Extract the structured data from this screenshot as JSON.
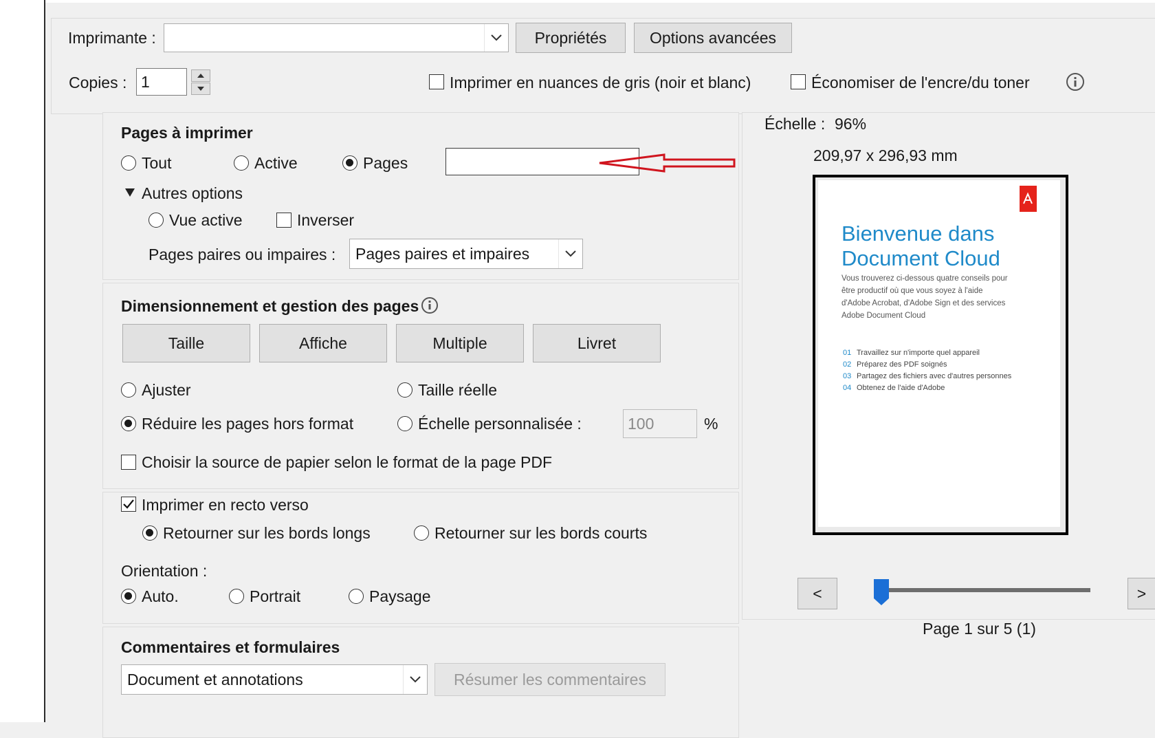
{
  "top": {
    "printer_label": "Imprimante :",
    "printer_value": "",
    "properties_button": "Propriétés",
    "advanced_button": "Options avancées",
    "copies_label": "Copies :",
    "copies_value": "1",
    "grayscale_label": "Imprimer en nuances de gris (noir et blanc)",
    "grayscale_checked": false,
    "save_ink_label": "Économiser de l'encre/du toner",
    "save_ink_checked": false
  },
  "pages_to_print": {
    "title": "Pages à imprimer",
    "all_label": "Tout",
    "current_label": "Active",
    "pages_label": "Pages",
    "selected": "Pages",
    "pages_value": "",
    "more_options_label": "Autres options",
    "current_view_label": "Vue active",
    "reverse_label": "Inverser",
    "odd_even_label": "Pages paires ou impaires :",
    "odd_even_value": "Pages paires et impaires"
  },
  "sizing": {
    "title": "Dimensionnement et gestion des pages",
    "tabs": [
      "Taille",
      "Affiche",
      "Multiple",
      "Livret"
    ],
    "fit_label": "Ajuster",
    "actual_size_label": "Taille réelle",
    "shrink_label": "Réduire les pages hors format",
    "custom_scale_label": "Échelle personnalisée :",
    "custom_scale_value": "100",
    "percent": "%",
    "selected": "Réduire les pages hors format",
    "paper_source_label": "Choisir la source de papier selon le format de la page PDF",
    "paper_source_checked": false
  },
  "duplex": {
    "duplex_label": "Imprimer en recto verso",
    "duplex_checked": true,
    "long_edge_label": "Retourner sur les bords longs",
    "short_edge_label": "Retourner sur les bords courts",
    "selected_flip": "Retourner sur les bords longs",
    "orientation_label": "Orientation :",
    "auto_label": "Auto.",
    "portrait_label": "Portrait",
    "landscape_label": "Paysage",
    "selected_orientation": "Auto."
  },
  "comments": {
    "title": "Commentaires et formulaires",
    "value": "Document et annotations",
    "summarize_button": "Résumer les commentaires"
  },
  "preview": {
    "scale_label": "Échelle :",
    "scale_value": "96%",
    "dimensions": "209,97 x 296,93 mm",
    "doc_title_line1": "Bienvenue dans",
    "doc_title_line2": "Document Cloud",
    "doc_body": [
      "Vous trouverez ci-dessous quatre conseils pour",
      "être productif où que vous soyez à l'aide",
      "d'Adobe Acrobat, d'Adobe Sign et des services",
      "Adobe Document Cloud"
    ],
    "doc_list": [
      {
        "num": "01",
        "text": "Travaillez sur n'importe quel appareil"
      },
      {
        "num": "02",
        "text": "Préparez des PDF soignés"
      },
      {
        "num": "03",
        "text": "Partagez des fichiers avec d'autres personnes"
      },
      {
        "num": "04",
        "text": "Obtenez de l'aide d'Adobe"
      }
    ],
    "prev_button": "<",
    "next_button": ">",
    "page_status": "Page 1 sur 5 (1)",
    "slider_position": 0
  },
  "colors": {
    "accent": "#1f8ac9",
    "annotation_arrow": "#d0151e",
    "adobe_red": "#e5231b",
    "slider_thumb": "#1b6fd6"
  }
}
